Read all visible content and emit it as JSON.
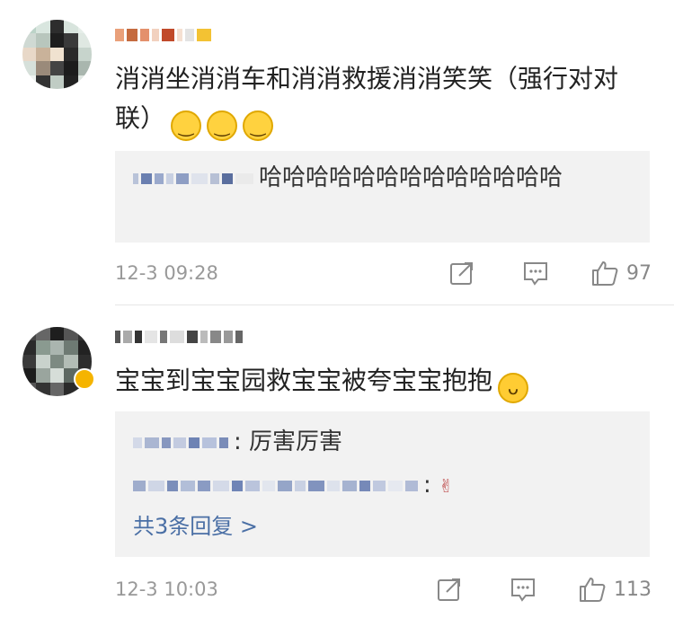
{
  "comments": [
    {
      "text": "消消坐消消车和消消救援消消笑笑（强行对对联）",
      "emojis": [
        "😂",
        "😂",
        "😂"
      ],
      "reply": {
        "text": "哈哈哈哈哈哈哈哈哈哈哈哈哈"
      },
      "time": "12-3 09:28",
      "likes": "97"
    },
    {
      "text": "宝宝到宝宝园救宝宝被夸宝宝抱抱",
      "emoji": "😋",
      "replies": [
        {
          "text": ": 厉害厉害"
        },
        {
          "text": ":",
          "emoji": "🤞"
        }
      ],
      "more_replies": "共3条回复 >",
      "time": "12-3 10:03",
      "likes": "113"
    }
  ],
  "icons": {
    "share": "share-icon",
    "comment": "comment-icon",
    "like": "thumbs-up-icon"
  },
  "colors": {
    "link": "#4a6fa5",
    "meta": "#999999",
    "reply_bg": "#f2f2f2"
  }
}
